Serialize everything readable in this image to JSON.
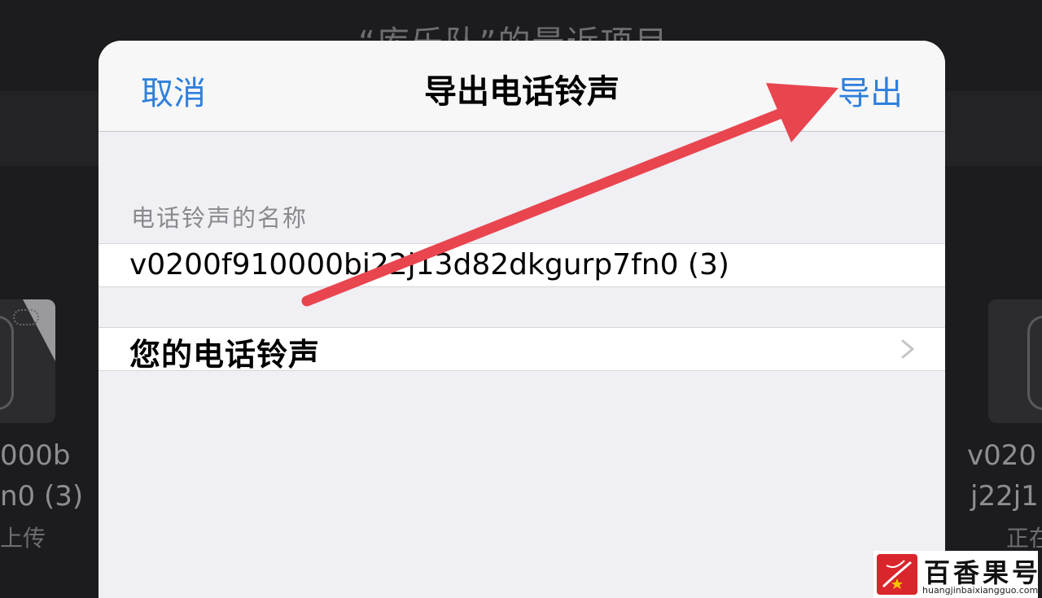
{
  "background": {
    "title": "“库乐队”的最近项目",
    "left_file": {
      "name_line1": "000b",
      "name_line2": "n0 (3)",
      "status": "上传"
    },
    "right_file": {
      "name_line1": "v020",
      "name_line2": "j22j1",
      "status": "正在"
    }
  },
  "sheet": {
    "cancel_label": "取消",
    "title": "导出电话铃声",
    "export_label": "导出",
    "name_section_header": "电话铃声的名称",
    "name_value": "v0200f910000bj22j13d82dkgurp7fn0 (3)",
    "your_ringtones_label": "您的电话铃声"
  },
  "icons": {
    "chevron": "chevron-right-icon",
    "arrow": "annotation-arrow-icon"
  },
  "colors": {
    "accent": "#2f7fdc",
    "arrow": "#e8454f"
  },
  "watermark": {
    "title": "百香果号",
    "url": "huangjinbaixiangguo.com"
  }
}
